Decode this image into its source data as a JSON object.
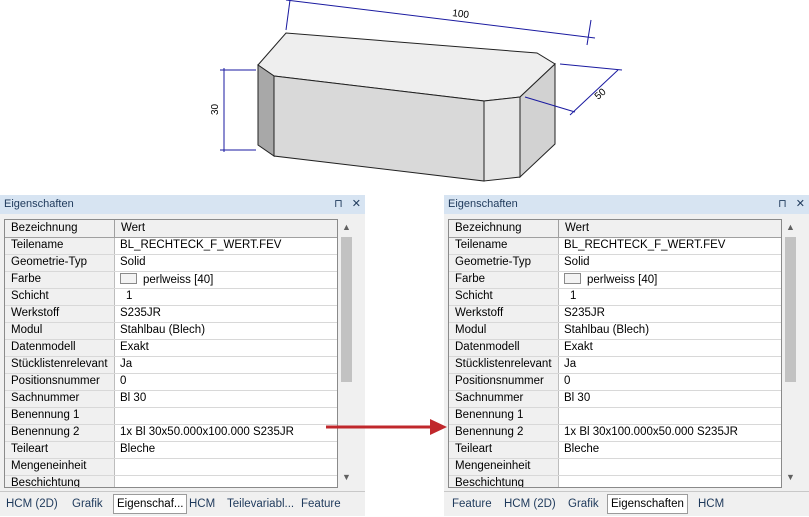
{
  "drawing": {
    "dim_length": "100",
    "dim_width": "50",
    "dim_height": "30"
  },
  "left_panel": {
    "title": "Eigenschaften",
    "pin_icon": "pin-icon",
    "close_icon": "close-icon",
    "header": {
      "name": "Bezeichnung",
      "value": "Wert"
    },
    "rows": [
      {
        "name": "Teilename",
        "value": "BL_RECHTECK_F_WERT.FEV"
      },
      {
        "name": "Geometrie-Typ",
        "value": "Solid"
      },
      {
        "name": "Farbe",
        "value": "perlweiss [40]"
      },
      {
        "name": "Schicht",
        "value": " 1"
      },
      {
        "name": "Werkstoff",
        "value": "S235JR"
      },
      {
        "name": "Modul",
        "value": "Stahlbau (Blech)"
      },
      {
        "name": "Datenmodell",
        "value": "Exakt"
      },
      {
        "name": "Stücklistenrelevant",
        "value": "Ja"
      },
      {
        "name": "Positionsnummer",
        "value": "0"
      },
      {
        "name": "Sachnummer",
        "value": "Bl 30"
      },
      {
        "name": "Benennung 1",
        "value": ""
      },
      {
        "name": "Benennung 2",
        "value": "1x Bl 30x50.000x100.000 S235JR"
      },
      {
        "name": "Teileart",
        "value": "Bleche"
      },
      {
        "name": "Mengeneinheit",
        "value": ""
      },
      {
        "name": "Beschichtung",
        "value": ""
      }
    ],
    "tabs": [
      "HCM (2D)",
      "Grafik",
      "Eigenschaf...",
      "HCM",
      "Teilevariabl...",
      "Feature"
    ],
    "active_tab": "Eigenschaf..."
  },
  "right_panel": {
    "title": "Eigenschaften",
    "pin_icon": "pin-icon",
    "close_icon": "close-icon",
    "header": {
      "name": "Bezeichnung",
      "value": "Wert"
    },
    "rows": [
      {
        "name": "Teilename",
        "value": "BL_RECHTECK_F_WERT.FEV"
      },
      {
        "name": "Geometrie-Typ",
        "value": "Solid"
      },
      {
        "name": "Farbe",
        "value": "perlweiss [40]"
      },
      {
        "name": "Schicht",
        "value": " 1"
      },
      {
        "name": "Werkstoff",
        "value": "S235JR"
      },
      {
        "name": "Modul",
        "value": "Stahlbau (Blech)"
      },
      {
        "name": "Datenmodell",
        "value": "Exakt"
      },
      {
        "name": "Stücklistenrelevant",
        "value": "Ja"
      },
      {
        "name": "Positionsnummer",
        "value": "0"
      },
      {
        "name": "Sachnummer",
        "value": "Bl 30"
      },
      {
        "name": "Benennung 1",
        "value": ""
      },
      {
        "name": "Benennung 2",
        "value": "1x Bl 30x100.000x50.000 S235JR"
      },
      {
        "name": "Teileart",
        "value": "Bleche"
      },
      {
        "name": "Mengeneinheit",
        "value": ""
      },
      {
        "name": "Beschichtung",
        "value": ""
      }
    ],
    "tabs": [
      "Feature",
      "HCM (2D)",
      "Grafik",
      "Eigenschaften",
      "HCM"
    ],
    "active_tab": "Eigenschaften"
  },
  "colors": {
    "titlebar": "#d7e4f2",
    "arrow": "#c0282c",
    "dimension_lines": "#1a1aa0"
  }
}
